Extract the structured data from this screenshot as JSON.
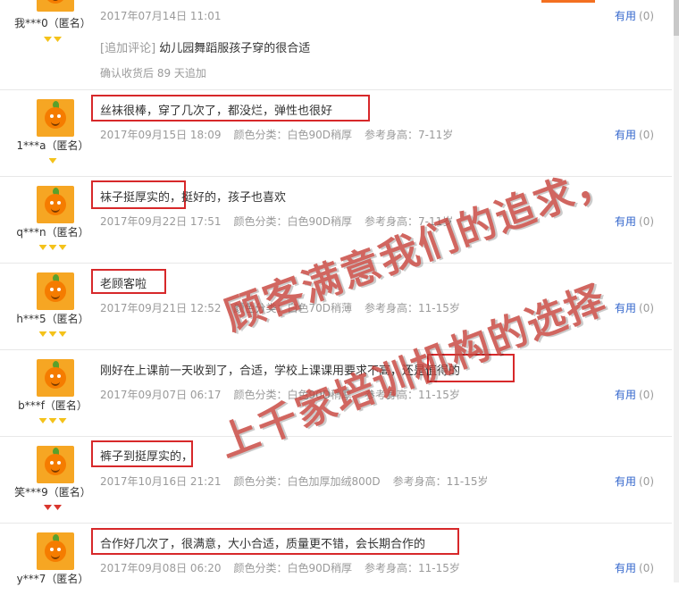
{
  "reviews": [
    {
      "nick": "我***0（匿名）",
      "content": "",
      "date": "2017年07月14日 11:01",
      "color": "",
      "height": "",
      "useful_label": "有用",
      "useful_count": "(0)",
      "append_tag": "[追加评论]",
      "append_text": "幼儿园舞蹈服孩子穿的很合适",
      "append_meta": "确认收货后 89 天追加",
      "gems": 2
    },
    {
      "nick": "1***a（匿名）",
      "content": "丝袜很棒，穿了几次了，都没烂，弹性也很好",
      "date": "2017年09月15日 18:09",
      "color": "颜色分类：白色90D稍厚",
      "height": "参考身高：7-11岁",
      "useful_label": "有用",
      "useful_count": "(0)",
      "gems": 1
    },
    {
      "nick": "q***n（匿名）",
      "content": "袜子挺厚实的，挺好的，孩子也喜欢",
      "date": "2017年09月22日 17:51",
      "color": "颜色分类：白色90D稍厚",
      "height": "参考身高：7-11岁",
      "useful_label": "有用",
      "useful_count": "(0)",
      "gems": 3
    },
    {
      "nick": "h***5（匿名）",
      "content": "老顾客啦",
      "date": "2017年09月21日 12:52",
      "color": "颜色分类：白色70D稍薄",
      "height": "参考身高：11-15岁",
      "useful_label": "有用",
      "useful_count": "(0)",
      "gems": 3
    },
    {
      "nick": "b***f（匿名）",
      "content": "刚好在上课前一天收到了，合适，学校上课课用要求不高，还是值得的",
      "date": "2017年09月07日 06:17",
      "color": "颜色分类：白色90D稍厚",
      "height": "参考身高：11-15岁",
      "useful_label": "有用",
      "useful_count": "(0)",
      "gems": 3
    },
    {
      "nick": "笑***9（匿名）",
      "content": "裤子到挺厚实的，",
      "date": "2017年10月16日 21:21",
      "color": "颜色分类：白色加厚加绒800D",
      "height": "参考身高：11-15岁",
      "useful_label": "有用",
      "useful_count": "(0)",
      "gems": 2,
      "gem_color": "#d9362e"
    },
    {
      "nick": "y***7（匿名）",
      "content": "合作好几次了，很满意，大小合适，质量更不错，会长期合作的",
      "date": "2017年09月08日 06:20",
      "color": "颜色分类：白色90D稍厚",
      "height": "参考身高：11-15岁",
      "useful_label": "有用",
      "useful_count": "(0)",
      "gems": 0
    }
  ],
  "watermark": {
    "line1": "顾客满意我们的追求，",
    "line2": "上千家培训机构的选择",
    "color": "#c8453e"
  },
  "colors": {
    "highlight_box": "#d7282a",
    "useful_link": "#3366cc",
    "meta_text": "#9a9a9a"
  }
}
